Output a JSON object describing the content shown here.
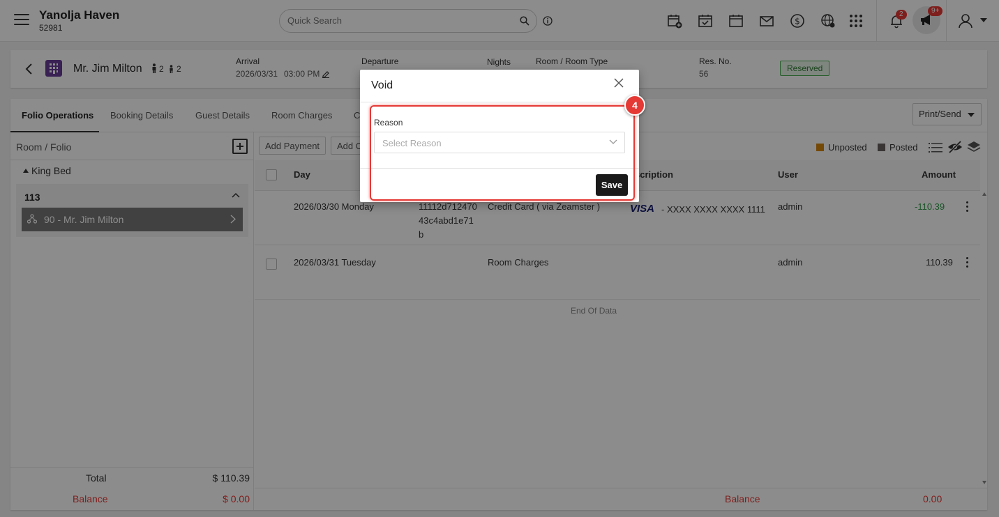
{
  "header": {
    "hotel_name": "Yanolja Haven",
    "hotel_id": "52981",
    "search_placeholder": "Quick Search",
    "notifications_count": "2",
    "announcements_count": "9+"
  },
  "reservation": {
    "guest_name": "Mr. Jim Milton",
    "adults": "2",
    "children": "2",
    "arrival_label": "Arrival",
    "arrival_date": "2026/03/31",
    "arrival_time": "03:00 PM",
    "departure_label": "Departure",
    "nights_label": "Nights",
    "room_label": "Room / Room Type",
    "resno_label": "Res. No.",
    "resno": "56",
    "status": "Reserved"
  },
  "tabs": [
    "Folio Operations",
    "Booking Details",
    "Guest Details",
    "Room Charges",
    "C"
  ],
  "print_label": "Print/Send",
  "left_panel": {
    "title": "Room / Folio",
    "room_type": "King Bed",
    "room_number": "113",
    "folio": "90 - Mr. Jim Milton",
    "total_label": "Total",
    "total_value": "$ 110.39",
    "balance_label": "Balance",
    "balance_value": "$ 0.00"
  },
  "actions": {
    "add_payment": "Add Payment",
    "add_other": "Add C"
  },
  "legend": {
    "unposted": "Unposted",
    "posted": "Posted"
  },
  "colors": {
    "unposted": "#d4860b",
    "posted": "#6b6161",
    "accent_red": "#e53935",
    "credit_green": "#2e9b48",
    "status_green": "#4caf50"
  },
  "table": {
    "headers": {
      "day": "Day",
      "description": "scription",
      "user": "User",
      "amount": "Amount"
    },
    "rows": [
      {
        "day": "2026/03/30 Monday",
        "ref": [
          "11112d712470",
          "43c4abd1e71",
          "b"
        ],
        "type": "Credit Card ( via Zeamster )",
        "card_brand": "VISA",
        "card_number": "- XXXX XXXX XXXX 1111",
        "user": "admin",
        "amount": "-110.39"
      },
      {
        "day": "2026/03/31 Tuesday",
        "type": "Room Charges",
        "user": "admin",
        "amount": "110.39"
      }
    ],
    "end_text": "End Of Data",
    "balance_label": "Balance",
    "balance_value": "0.00"
  },
  "modal": {
    "title": "Void",
    "reason_label": "Reason",
    "reason_placeholder": "Select Reason",
    "save_label": "Save",
    "step_number": "4"
  }
}
